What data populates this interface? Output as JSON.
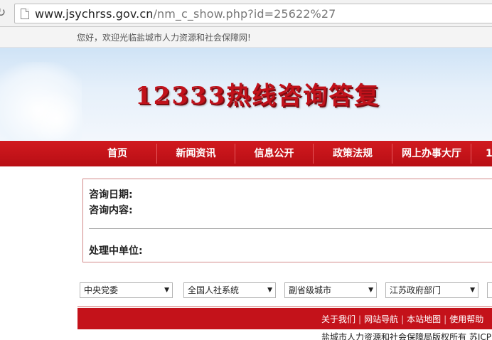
{
  "browser": {
    "url_host": "www.jsychrss.gov.cn",
    "url_path": "/nm_c_show.php?id=25622%27"
  },
  "welcome": "您好，欢迎光临盐城市人力资源和社会保障网!",
  "banner": {
    "title": "12333热线咨询答复"
  },
  "nav": {
    "items": [
      "首页",
      "新闻资讯",
      "信息公开",
      "政策法规",
      "网上办事大厅",
      "1"
    ]
  },
  "consult": {
    "date_label": "咨询日期:",
    "content_label": "咨询内容:",
    "unit_label": "处理中单位:"
  },
  "selects": [
    "中央党委",
    "全国人社系统",
    "副省级城市",
    "江苏政府部门"
  ],
  "footer": {
    "links": [
      "关于我们",
      "网站导航",
      "本站地图",
      "使用帮助"
    ],
    "copyright": "盐城市人力资源和社会保障局版权所有  苏ICP"
  },
  "colors": {
    "brand_red": "#c4121a",
    "nav_red": "#c3141a"
  }
}
